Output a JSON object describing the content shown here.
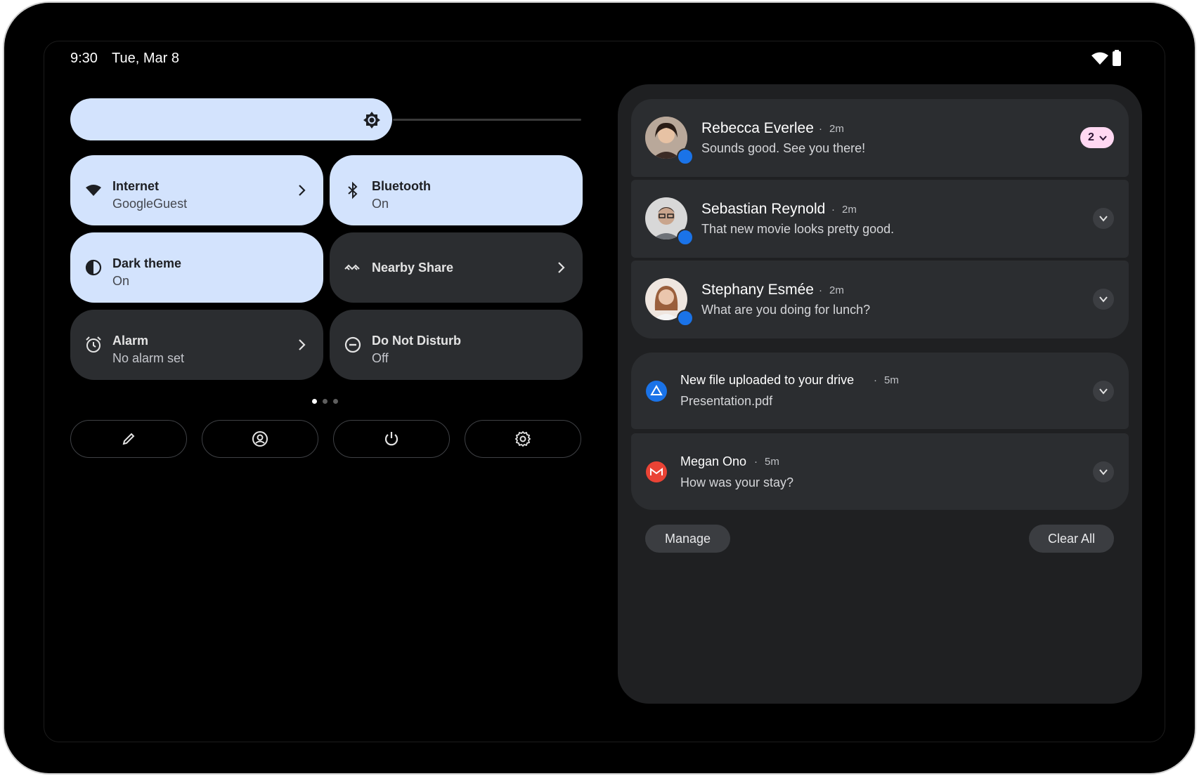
{
  "status_bar": {
    "time": "9:30",
    "date": "Tue, Mar 8",
    "icons": [
      "wifi-icon",
      "battery-icon"
    ]
  },
  "brightness": {
    "icon": "brightness-icon",
    "level": 0.63
  },
  "tiles": [
    {
      "id": "internet",
      "title": "Internet",
      "subtitle": "GoogleGuest",
      "state": "on",
      "icon": "wifi-icon",
      "chevron": true
    },
    {
      "id": "bluetooth",
      "title": "Bluetooth",
      "subtitle": "On",
      "state": "on",
      "icon": "bluetooth-icon",
      "chevron": false
    },
    {
      "id": "dark-theme",
      "title": "Dark theme",
      "subtitle": "On",
      "state": "on",
      "icon": "contrast-icon",
      "chevron": false
    },
    {
      "id": "nearby-share",
      "title": "Nearby Share",
      "subtitle": "",
      "state": "off",
      "icon": "nearby-share-icon",
      "chevron": true
    },
    {
      "id": "alarm",
      "title": "Alarm",
      "subtitle": "No alarm set",
      "state": "off",
      "icon": "alarm-icon",
      "chevron": true
    },
    {
      "id": "dnd",
      "title": "Do Not Disturb",
      "subtitle": "Off",
      "state": "off",
      "icon": "do-not-disturb-icon",
      "chevron": false
    }
  ],
  "page_indicator": {
    "pages": 3,
    "current": 1
  },
  "quick_buttons": [
    "edit-icon",
    "user-icon",
    "power-icon",
    "settings-icon"
  ],
  "notifications": {
    "conversations": [
      {
        "name": "Rebecca Everlee",
        "time": "2m",
        "message": "Sounds good. See you there!",
        "count": "2",
        "avatar": "rebecca-avatar"
      },
      {
        "name": "Sebastian Reynold",
        "time": "2m",
        "message": "That new movie looks pretty good.",
        "avatar": "sebastian-avatar"
      },
      {
        "name": "Stephany Esmée",
        "time": "2m",
        "message": "What are you doing for lunch?",
        "avatar": "stephany-avatar"
      }
    ],
    "alerts": [
      {
        "title": "New file uploaded to your drive",
        "time": "5m",
        "message": "Presentation.pdf",
        "icon": "drive-icon",
        "color": "#1a73e8"
      },
      {
        "title": "Megan Ono",
        "time": "5m",
        "message": "How was your stay?",
        "icon": "gmail-icon",
        "color": "#ea4335"
      }
    ],
    "manage_label": "Manage",
    "clear_all_label": "Clear All"
  },
  "colors": {
    "tile_on": "#d3e3fd",
    "tile_off": "#2b2d30",
    "panel": "#1f2022",
    "card": "#2b2d30",
    "badge_pill": "#ffd8f2"
  }
}
